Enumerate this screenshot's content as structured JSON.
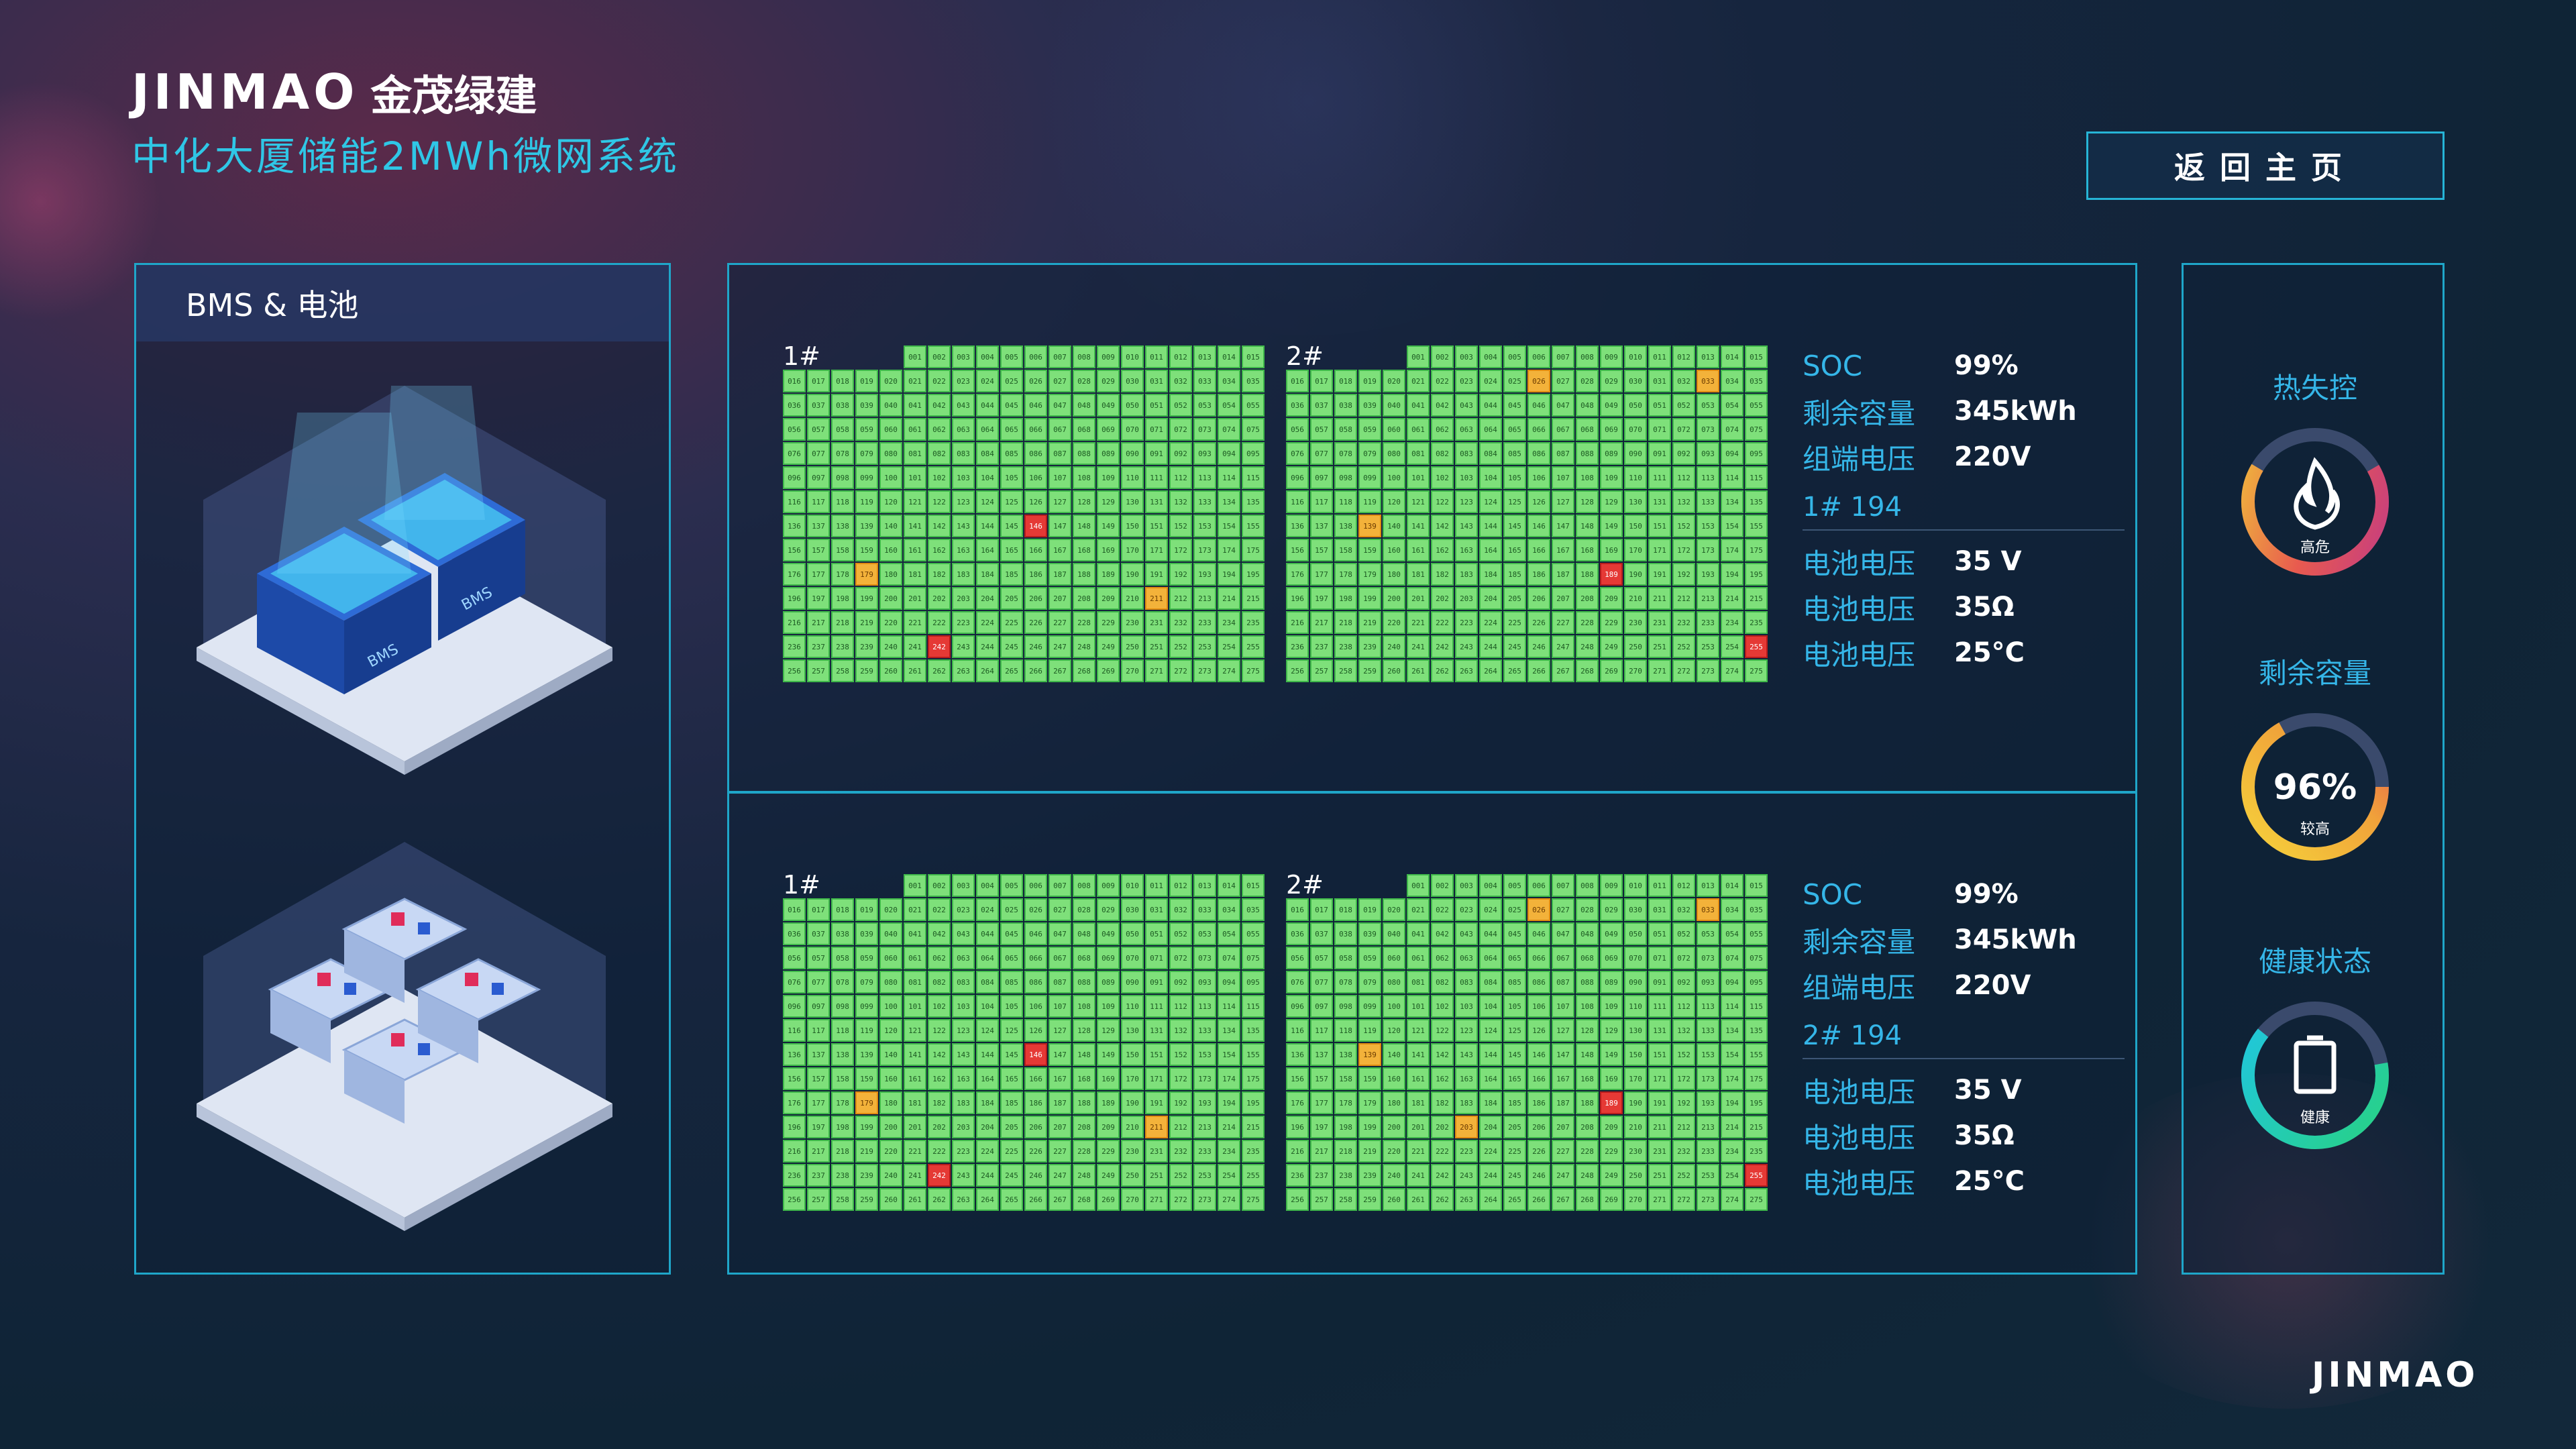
{
  "brand": {
    "logo_text": "JINMAO",
    "logo_cn": "金茂绿建",
    "subtitle": "中化大厦储能2MWh微网系统",
    "footer_logo": "JINMAO"
  },
  "header": {
    "home_button": "返回主页"
  },
  "left_panel": {
    "title": "BMS & 电池"
  },
  "blocks": [
    {
      "packs": [
        {
          "label": "1#",
          "warn": [
            179,
            211
          ],
          "alarm": [
            146,
            242
          ]
        },
        {
          "label": "2#",
          "warn": [
            26,
            33,
            139
          ],
          "alarm": [
            189,
            255
          ]
        }
      ],
      "stats": [
        {
          "label": "SOC",
          "value": "99%"
        },
        {
          "label": "剩余容量",
          "value": "345kWh"
        },
        {
          "label": "组端电压",
          "value": "220V"
        }
      ],
      "cell_title": "1# 194",
      "cell_stats": [
        {
          "label": "电池电压",
          "value": "35 V"
        },
        {
          "label": "电池电压",
          "value": "35Ω"
        },
        {
          "label": "电池电压",
          "value": "25°C"
        }
      ]
    },
    {
      "packs": [
        {
          "label": "1#",
          "warn": [
            179,
            211
          ],
          "alarm": [
            146,
            242
          ]
        },
        {
          "label": "2#",
          "warn": [
            26,
            33,
            139,
            203
          ],
          "alarm": [
            189,
            255
          ]
        }
      ],
      "stats": [
        {
          "label": "SOC",
          "value": "99%"
        },
        {
          "label": "剩余容量",
          "value": "345kWh"
        },
        {
          "label": "组端电压",
          "value": "220V"
        }
      ],
      "cell_title": "2# 194",
      "cell_stats": [
        {
          "label": "电池电压",
          "value": "35 V"
        },
        {
          "label": "电池电压",
          "value": "35Ω"
        },
        {
          "label": "电池电压",
          "value": "25°C"
        }
      ]
    }
  ],
  "gauges": [
    {
      "title": "热失控",
      "status": "高危",
      "icon": "fire-icon",
      "colors": [
        "#f0c23a",
        "#e85a4f",
        "#c23a86"
      ]
    },
    {
      "title": "剩余容量",
      "value": "96%",
      "status": "较高",
      "icon": "",
      "colors": [
        "#f0c23a",
        "#e85a4f",
        "#f5d23b"
      ]
    },
    {
      "title": "健康状态",
      "status": "健康",
      "icon": "battery-icon",
      "colors": [
        "#2bd6a0",
        "#20c6e0",
        "#28d184"
      ]
    }
  ],
  "colors": {
    "accent": "#2fc7e6",
    "cell_ok": "#7ee07a",
    "cell_warn": "#f3b23a",
    "cell_alarm": "#e53935"
  }
}
